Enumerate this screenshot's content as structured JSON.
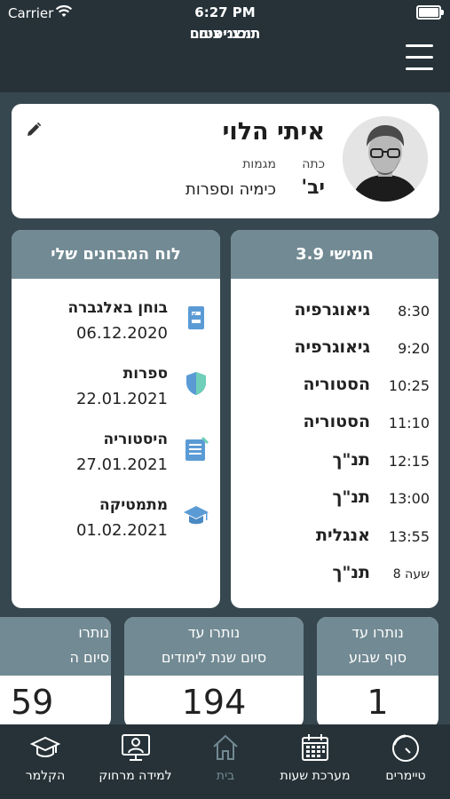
{
  "status_bar": {
    "carrier": "Carrier",
    "time": "6:27 PM"
  },
  "app": {
    "logo_line1": "תיכוניסטים",
    "logo_line2": "מצ״צים"
  },
  "profile": {
    "name": "איתי הלוי",
    "class_label": "כתה",
    "class_value": "יב'",
    "majors_label": "מגמות",
    "majors_value": "כימיה וספרות"
  },
  "schedule": {
    "title": "חמישי 3.9",
    "rows": [
      {
        "time": "8:30",
        "subject": "גיאוגרפיה"
      },
      {
        "time": "9:20",
        "subject": "גיאוגרפיה"
      },
      {
        "time": "10:25",
        "subject": "הסטוריה"
      },
      {
        "time": "11:10",
        "subject": "הסטוריה"
      },
      {
        "time": "12:15",
        "subject": "תנ\"ך"
      },
      {
        "time": "13:00",
        "subject": "תנ\"ך"
      },
      {
        "time": "13:55",
        "subject": "אנגלית"
      },
      {
        "time": "שעה 8",
        "subject": "תנ\"ך"
      }
    ]
  },
  "exams": {
    "title": "לוח המבחנים שלי",
    "rows": [
      {
        "name": "בוחן באלגברה",
        "date": "06.12.2020",
        "icon": "checklist-icon"
      },
      {
        "name": "ספרות",
        "date": "22.01.2021",
        "icon": "shield-icon"
      },
      {
        "name": "היסטוריה",
        "date": "27.01.2021",
        "icon": "document-icon"
      },
      {
        "name": "מתמטיקה",
        "date": "01.02.2021",
        "icon": "graduation-cap-icon"
      }
    ]
  },
  "counters": [
    {
      "line1": "נותרו עד",
      "line2": "סוף שבוע",
      "value": "1"
    },
    {
      "line1": "נותרו עד",
      "line2": "סיום שנת לימודים",
      "value": "194"
    },
    {
      "line1": "נותרו",
      "line2": "סיום ה",
      "value": "59"
    }
  ],
  "tabs": [
    {
      "label": "טיימרים",
      "icon": "timer-icon"
    },
    {
      "label": "מערכת שעות",
      "icon": "calendar-icon"
    },
    {
      "label": "בית",
      "icon": "home-icon"
    },
    {
      "label": "למידה מרחוק",
      "icon": "monitor-person-icon"
    },
    {
      "label": "הקלמר",
      "icon": "graduation-cap-icon"
    }
  ],
  "colors": {
    "header": "#728a93",
    "background": "#37474f",
    "bar": "#263238",
    "active_tab": "#728a93"
  }
}
